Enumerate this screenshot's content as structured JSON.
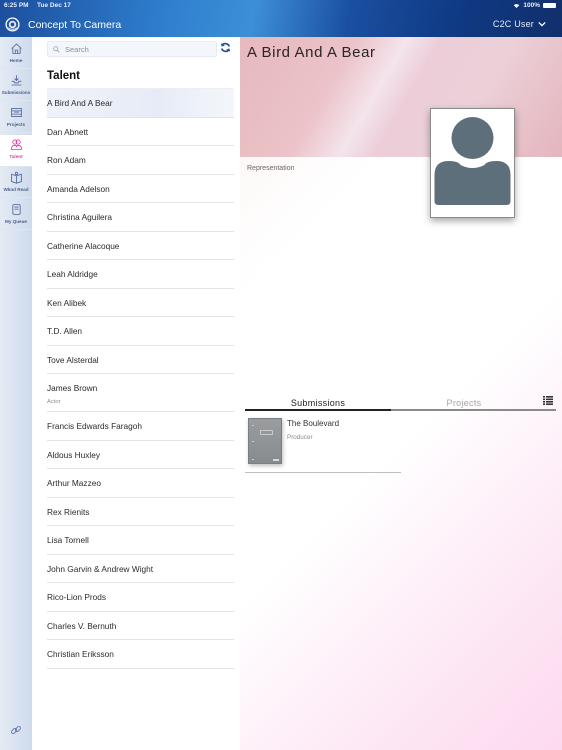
{
  "status_bar": {
    "time": "6:25 PM",
    "date": "Tue Dec 17",
    "battery": "100%"
  },
  "header": {
    "app_title": "Concept To Camera",
    "user_menu": "C2C User"
  },
  "sidebar": {
    "items": [
      {
        "label": "Home",
        "icon": "home-icon",
        "active": false
      },
      {
        "label": "Submissions",
        "icon": "inbox-download-icon",
        "active": false
      },
      {
        "label": "Projects",
        "icon": "film-icon",
        "active": false
      },
      {
        "label": "Talent",
        "icon": "people-icon",
        "active": true
      },
      {
        "label": "Wknd Read",
        "icon": "open-book-icon",
        "active": false
      },
      {
        "label": "My Queue",
        "icon": "document-icon",
        "active": false
      }
    ],
    "footer_icon": "link-icon"
  },
  "colors": {
    "header_blue": "#1c4f9e",
    "active_pink": "#e23aa1",
    "avatar_slate": "#5d6f7a"
  },
  "list_panel": {
    "search": {
      "placeholder": "Search",
      "value": ""
    },
    "title": "Talent",
    "selected_index": 0,
    "items": [
      {
        "name": "A Bird And A Bear",
        "role": ""
      },
      {
        "name": "Dan Abnett",
        "role": ""
      },
      {
        "name": "Ron Adam",
        "role": ""
      },
      {
        "name": "Amanda Adelson",
        "role": ""
      },
      {
        "name": "Christina Aguilera",
        "role": ""
      },
      {
        "name": "Catherine Alacoque",
        "role": ""
      },
      {
        "name": "Leah Aldridge",
        "role": ""
      },
      {
        "name": "Ken Alibek",
        "role": ""
      },
      {
        "name": "T.D. Allen",
        "role": ""
      },
      {
        "name": "Tove Alsterdal",
        "role": ""
      },
      {
        "name": "James Brown",
        "role": "Actor"
      },
      {
        "name": "Francis Edwards Faragoh",
        "role": ""
      },
      {
        "name": "Aldous Huxley",
        "role": ""
      },
      {
        "name": "Arthur Mazzeo",
        "role": ""
      },
      {
        "name": "Rex Rienits",
        "role": ""
      },
      {
        "name": "Lisa Tornell",
        "role": ""
      },
      {
        "name": "John Garvin & Andrew Wight",
        "role": ""
      },
      {
        "name": "Rico-Lion Prods",
        "role": ""
      },
      {
        "name": "Charles V. Bernuth",
        "role": ""
      },
      {
        "name": "Christian Eriksson",
        "role": ""
      }
    ]
  },
  "detail": {
    "title": "A Bird And A Bear",
    "representation_label": "Representation",
    "tabs": [
      {
        "label": "Submissions",
        "active": true
      },
      {
        "label": "Projects",
        "active": false
      }
    ],
    "submissions": [
      {
        "title": "The Boulevard",
        "role": "Producer"
      }
    ]
  }
}
